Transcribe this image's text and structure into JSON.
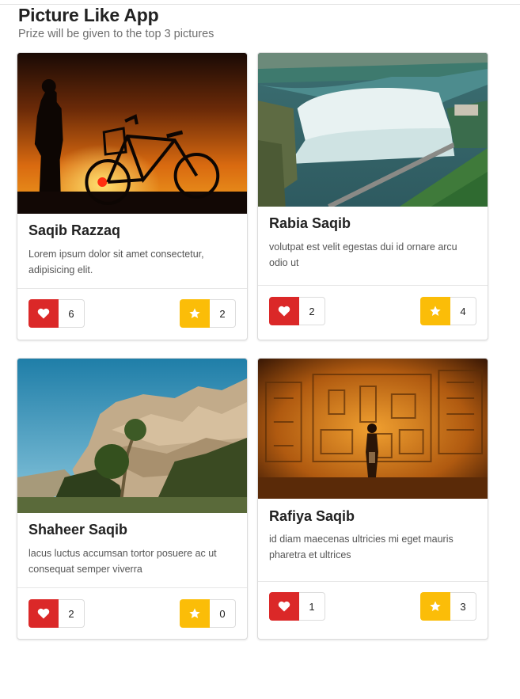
{
  "header": {
    "title": "Picture Like App",
    "subtitle": "Prize will be given to the top 3 pictures"
  },
  "icons": {
    "like": "heart-icon",
    "star": "star-icon"
  },
  "colors": {
    "like": "#db2828",
    "star": "#fbbd08"
  },
  "pictures": [
    {
      "name": "Saqib Razzaq",
      "description": "Lorem ipsum dolor sit amet consectetur, adipisicing elit.",
      "likes": "6",
      "stars": "2",
      "image": "sunset silhouette with bicycle"
    },
    {
      "name": "Rabia Saqib",
      "description": "volutpat est velit egestas dui id ornare arcu odio ut",
      "likes": "2",
      "stars": "4",
      "image": "waterfall aerial view"
    },
    {
      "name": "Shaheer Saqib",
      "description": "lacus luctus accumsan tortor posuere ac ut consequat semper viverra",
      "likes": "2",
      "stars": "0",
      "image": "desert rock formation"
    },
    {
      "name": "Rafiya Saqib",
      "description": "id diam maecenas ultricies mi eget mauris pharetra et ultrices",
      "likes": "1",
      "stars": "3",
      "image": "woman in ancient carved hall"
    }
  ]
}
